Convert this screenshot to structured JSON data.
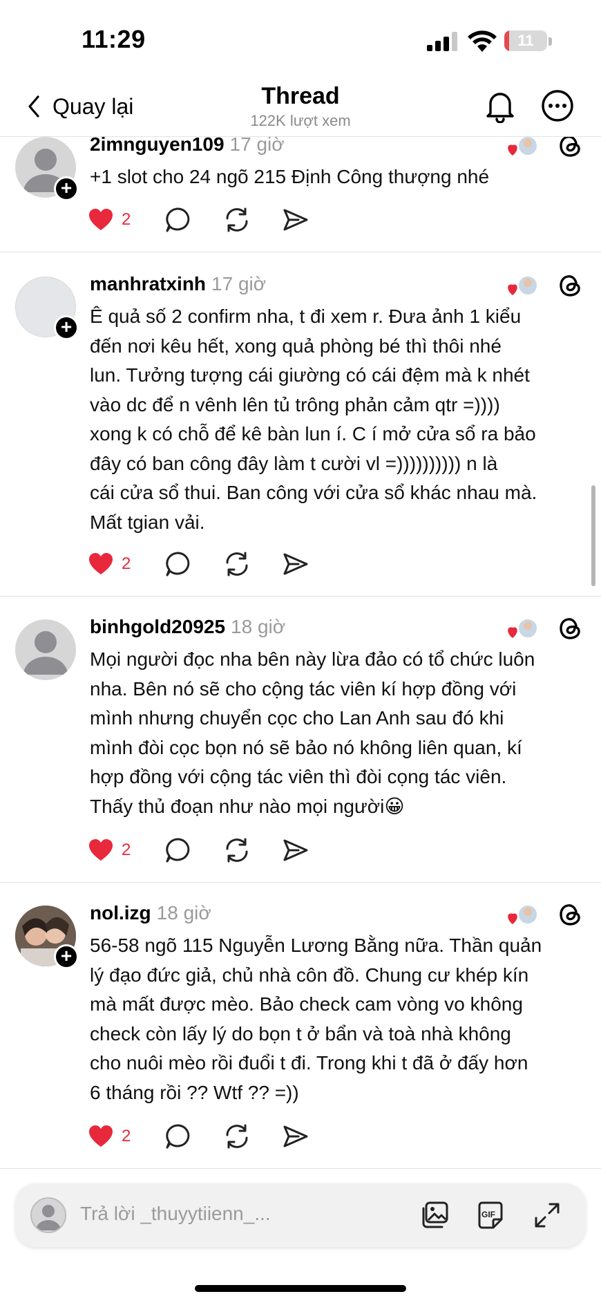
{
  "status_bar": {
    "time": "11:29",
    "battery": "11",
    "battery_level": 0.11
  },
  "header": {
    "back_label": "Quay lại",
    "title": "Thread",
    "subtitle": "122K lượt xem",
    "icons": [
      "bell-icon",
      "more-icon"
    ]
  },
  "posts": [
    {
      "username": "2imnguyen109",
      "time": "17 giờ",
      "lines": [
        "+1 slot cho 24 ngõ 215 Định Công thượng nhé"
      ],
      "likes": "2"
    },
    {
      "username": "manhratxinh",
      "time": "17 giờ",
      "lines": [
        "Ê quả số 2 confirm nha, t đi xem r. Đưa ảnh 1 kiểu",
        "đến nơi kêu hết, xong quả phòng bé thì thôi nhé",
        "lun. Tưởng tượng cái giường có cái đệm mà k nhét",
        "vào dc để n vênh lên tủ trông phản cảm qtr =))))",
        "xong k có chỗ để kê bàn lun í. C í mở cửa sổ ra bảo",
        "đây có ban công đây làm t cười vl =)))))))))) n là",
        "cái cửa sổ thui. Ban công với cửa sổ khác nhau mà.",
        "Mất tgian vải."
      ],
      "likes": "2"
    },
    {
      "username": "binhgold20925",
      "time": "18 giờ",
      "lines": [
        "Mọi người đọc nha bên này lừa đảo có tổ chức luôn",
        "nha. Bên nó sẽ cho cộng tác viên kí hợp đồng với",
        "mình nhưng chuyển cọc cho Lan Anh sau đó khi",
        "mình đòi cọc bọn nó sẽ bảo nó không liên quan, kí",
        "hợp đồng với cộng tác viên thì đòi cọng tác viên.",
        "Thấy thủ đoạn như nào mọi người😀"
      ],
      "likes": "2"
    },
    {
      "username": "nol.izg",
      "time": "18 giờ",
      "lines": [
        "56-58 ngõ 115 Nguyễn Lương Bằng nữa. Thần quản",
        "lý đạo đức giả, chủ nhà côn đồ. Chung cư khép kín",
        "mà mất được mèo. Bảo check cam vòng vo không",
        "check còn lấy lý do bọn t ở bẩn và toà nhà không",
        "cho nuôi mèo rồi đuổi t đi. Trong khi t đã ở đấy hơn",
        "6 tháng rồi ?? Wtf ?? =))"
      ],
      "likes": "2"
    }
  ],
  "reply_bar": {
    "placeholder": "Trả lời _thuyytiienn_..."
  },
  "colors": {
    "like_red": "#e8283b",
    "muted_gray": "#9a9a9a",
    "divider": "#e3e3e3"
  }
}
